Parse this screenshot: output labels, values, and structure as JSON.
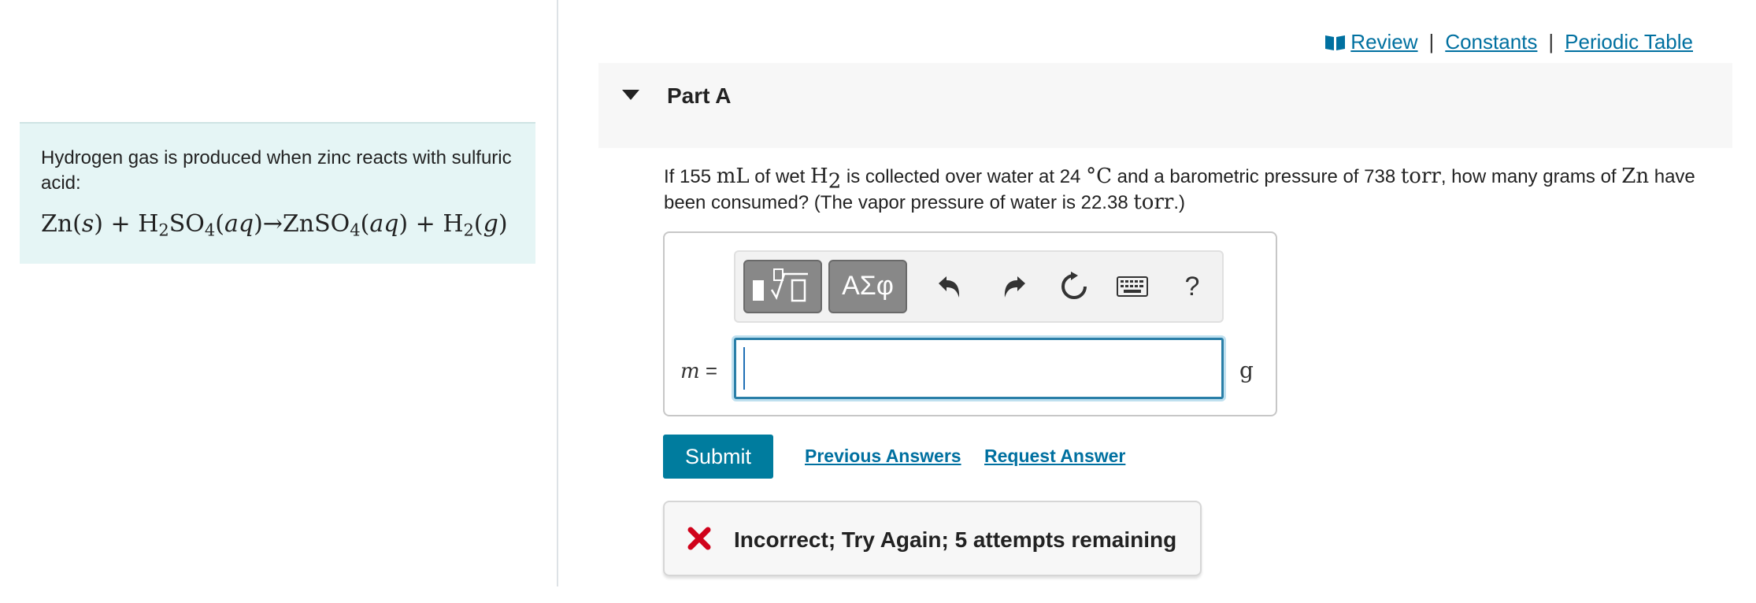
{
  "colors": {
    "accent": "#007c9e",
    "link": "#0070a0",
    "panel_bg": "#e5f5f5",
    "error": "#d0021b"
  },
  "intro": {
    "text": "Hydrogen gas is produced when zinc reacts with sulfuric acid:",
    "equation_parts": {
      "zn": "Zn(",
      "s": "s",
      "plus1": ") + H",
      "sub2a": "2",
      "so4a": "SO",
      "sub4a": "4",
      "aq1open": "(",
      "aq1": "aq",
      "arrow": ")→ZnSO",
      "sub4b": "4",
      "aq2open": "(",
      "aq2": "aq",
      "plus2": ") + H",
      "sub2b": "2",
      "gopen": "(",
      "g": "g",
      "close": ")"
    }
  },
  "resources": {
    "review": "Review",
    "separator": "|",
    "constants": "Constants",
    "periodic_table": "Periodic Table"
  },
  "part": {
    "title": "Part A"
  },
  "question": {
    "t1": "If 155 ",
    "unit_ml": "mL",
    "t2": " of wet ",
    "h": "H",
    "h_sub": "2",
    "t3": " is collected over water at 24 ",
    "deg": "°C",
    "t4": " and a barometric pressure of 738 ",
    "torr1": "torr",
    "t5": ", how many grams of ",
    "zn": "Zn",
    "t6": " have been consumed? (The vapor pressure of water is 22.38 ",
    "torr2": "torr",
    "t7": ".)"
  },
  "answer": {
    "variable": "m",
    "equals": " =",
    "unit": "g",
    "value": "",
    "toolbar": {
      "greek_label": "ΑΣφ",
      "help_label": "?"
    },
    "icons": [
      "templates-icon",
      "undo-icon",
      "redo-icon",
      "reset-icon",
      "keyboard-icon",
      "help-icon"
    ]
  },
  "actions": {
    "submit": "Submit",
    "previous_answers": "Previous Answers",
    "request_answer": "Request Answer"
  },
  "feedback": {
    "message": "Incorrect; Try Again; 5 attempts remaining"
  }
}
